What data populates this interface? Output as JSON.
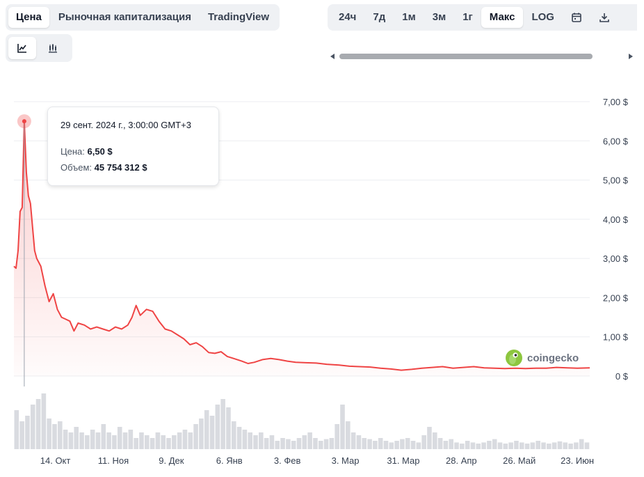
{
  "tabs": [
    {
      "label": "Цена",
      "active": true
    },
    {
      "label": "Рыночная капитализация",
      "active": false
    },
    {
      "label": "TradingView",
      "active": false
    }
  ],
  "chart_types": [
    {
      "icon": "line-chart-icon",
      "active": true
    },
    {
      "icon": "candlestick-chart-icon",
      "active": false
    }
  ],
  "ranges": [
    {
      "label": "24ч",
      "active": false
    },
    {
      "label": "7д",
      "active": false
    },
    {
      "label": "1м",
      "active": false
    },
    {
      "label": "3м",
      "active": false
    },
    {
      "label": "1г",
      "active": false
    },
    {
      "label": "Макс",
      "active": true
    },
    {
      "label": "LOG",
      "active": false
    }
  ],
  "range_icons": [
    "calendar-icon",
    "download-icon"
  ],
  "tooltip": {
    "date": "29 сент. 2024 г., 3:00:00 GMT+3",
    "price_label": "Цена:",
    "price_value": "6,50 $",
    "volume_label": "Объем:",
    "volume_value": "45 754 312 $"
  },
  "watermark": {
    "text": "coingecko",
    "icon": "gecko-logo-icon"
  },
  "colors": {
    "line": "#ef4444",
    "fill": "#fde2e2",
    "volume": "#d9dbe0",
    "grid": "#eceef1"
  },
  "chart_data": {
    "type": "area",
    "x_start": "2024-09-24",
    "x_end": "2025-06-29",
    "xticks": [
      {
        "label": "14. Окт",
        "date": "2024-10-14"
      },
      {
        "label": "11. Ноя",
        "date": "2024-11-11"
      },
      {
        "label": "9. Дек",
        "date": "2024-12-09"
      },
      {
        "label": "6. Янв",
        "date": "2025-01-06"
      },
      {
        "label": "3. Фев",
        "date": "2025-02-03"
      },
      {
        "label": "3. Мар",
        "date": "2025-03-03"
      },
      {
        "label": "31. Мар",
        "date": "2025-03-31"
      },
      {
        "label": "28. Апр",
        "date": "2025-04-28"
      },
      {
        "label": "26. Май",
        "date": "2025-05-26"
      },
      {
        "label": "23. Июн",
        "date": "2025-06-23"
      }
    ],
    "yticks": [
      "0 $",
      "1,00 $",
      "2,00 $",
      "3,00 $",
      "4,00 $",
      "5,00 $",
      "6,00 $",
      "7,00 $"
    ],
    "ylim": [
      0,
      7
    ],
    "grid": true,
    "highlight": {
      "date": "2024-09-29",
      "price": 6.5
    },
    "price": [
      [
        "2024-09-24",
        2.8
      ],
      [
        "2024-09-25",
        2.75
      ],
      [
        "2024-09-26",
        3.2
      ],
      [
        "2024-09-27",
        4.2
      ],
      [
        "2024-09-28",
        4.3
      ],
      [
        "2024-09-29",
        6.5
      ],
      [
        "2024-09-30",
        5.2
      ],
      [
        "2024-10-01",
        4.6
      ],
      [
        "2024-10-02",
        4.4
      ],
      [
        "2024-10-03",
        3.8
      ],
      [
        "2024-10-04",
        3.2
      ],
      [
        "2024-10-05",
        3.0
      ],
      [
        "2024-10-07",
        2.8
      ],
      [
        "2024-10-09",
        2.3
      ],
      [
        "2024-10-11",
        1.9
      ],
      [
        "2024-10-13",
        2.1
      ],
      [
        "2024-10-15",
        1.7
      ],
      [
        "2024-10-17",
        1.5
      ],
      [
        "2024-10-19",
        1.45
      ],
      [
        "2024-10-21",
        1.4
      ],
      [
        "2024-10-23",
        1.15
      ],
      [
        "2024-10-25",
        1.35
      ],
      [
        "2024-10-28",
        1.3
      ],
      [
        "2024-10-31",
        1.2
      ],
      [
        "2024-11-03",
        1.25
      ],
      [
        "2024-11-06",
        1.2
      ],
      [
        "2024-11-09",
        1.15
      ],
      [
        "2024-11-12",
        1.25
      ],
      [
        "2024-11-15",
        1.2
      ],
      [
        "2024-11-18",
        1.3
      ],
      [
        "2024-11-20",
        1.5
      ],
      [
        "2024-11-22",
        1.8
      ],
      [
        "2024-11-24",
        1.55
      ],
      [
        "2024-11-27",
        1.7
      ],
      [
        "2024-11-30",
        1.65
      ],
      [
        "2024-12-03",
        1.4
      ],
      [
        "2024-12-06",
        1.2
      ],
      [
        "2024-12-09",
        1.15
      ],
      [
        "2024-12-12",
        1.05
      ],
      [
        "2024-12-15",
        0.95
      ],
      [
        "2024-12-18",
        0.8
      ],
      [
        "2024-12-21",
        0.85
      ],
      [
        "2024-12-24",
        0.75
      ],
      [
        "2024-12-27",
        0.6
      ],
      [
        "2024-12-30",
        0.58
      ],
      [
        "2025-01-02",
        0.62
      ],
      [
        "2025-01-05",
        0.5
      ],
      [
        "2025-01-08",
        0.45
      ],
      [
        "2025-01-12",
        0.38
      ],
      [
        "2025-01-15",
        0.32
      ],
      [
        "2025-01-18",
        0.35
      ],
      [
        "2025-01-22",
        0.42
      ],
      [
        "2025-01-26",
        0.45
      ],
      [
        "2025-01-30",
        0.42
      ],
      [
        "2025-02-03",
        0.38
      ],
      [
        "2025-02-07",
        0.35
      ],
      [
        "2025-02-12",
        0.34
      ],
      [
        "2025-02-17",
        0.33
      ],
      [
        "2025-02-22",
        0.3
      ],
      [
        "2025-02-28",
        0.28
      ],
      [
        "2025-03-05",
        0.25
      ],
      [
        "2025-03-10",
        0.24
      ],
      [
        "2025-03-15",
        0.23
      ],
      [
        "2025-03-20",
        0.2
      ],
      [
        "2025-03-25",
        0.18
      ],
      [
        "2025-03-30",
        0.15
      ],
      [
        "2025-04-04",
        0.17
      ],
      [
        "2025-04-09",
        0.2
      ],
      [
        "2025-04-14",
        0.22
      ],
      [
        "2025-04-19",
        0.24
      ],
      [
        "2025-04-24",
        0.2
      ],
      [
        "2025-04-29",
        0.22
      ],
      [
        "2025-05-04",
        0.24
      ],
      [
        "2025-05-09",
        0.21
      ],
      [
        "2025-05-14",
        0.2
      ],
      [
        "2025-05-19",
        0.19
      ],
      [
        "2025-05-24",
        0.2
      ],
      [
        "2025-05-29",
        0.19
      ],
      [
        "2025-06-03",
        0.2
      ],
      [
        "2025-06-08",
        0.2
      ],
      [
        "2025-06-13",
        0.22
      ],
      [
        "2025-06-18",
        0.21
      ],
      [
        "2025-06-23",
        0.2
      ],
      [
        "2025-06-29",
        0.21
      ]
    ],
    "volume_relative": [
      0.7,
      0.5,
      0.6,
      0.8,
      0.9,
      1.0,
      0.55,
      0.45,
      0.5,
      0.35,
      0.3,
      0.4,
      0.3,
      0.25,
      0.35,
      0.3,
      0.45,
      0.3,
      0.25,
      0.4,
      0.3,
      0.35,
      0.2,
      0.3,
      0.25,
      0.2,
      0.3,
      0.25,
      0.2,
      0.25,
      0.3,
      0.35,
      0.3,
      0.45,
      0.55,
      0.7,
      0.6,
      0.8,
      0.9,
      0.75,
      0.5,
      0.4,
      0.35,
      0.3,
      0.25,
      0.3,
      0.2,
      0.25,
      0.15,
      0.2,
      0.18,
      0.15,
      0.2,
      0.25,
      0.3,
      0.2,
      0.15,
      0.18,
      0.2,
      0.45,
      0.8,
      0.5,
      0.3,
      0.25,
      0.2,
      0.18,
      0.15,
      0.2,
      0.15,
      0.12,
      0.15,
      0.18,
      0.2,
      0.15,
      0.12,
      0.25,
      0.4,
      0.3,
      0.2,
      0.15,
      0.18,
      0.12,
      0.1,
      0.15,
      0.12,
      0.1,
      0.12,
      0.15,
      0.18,
      0.12,
      0.1,
      0.12,
      0.15,
      0.12,
      0.1,
      0.12,
      0.15,
      0.12,
      0.1,
      0.12,
      0.14,
      0.12,
      0.1,
      0.12,
      0.18,
      0.12
    ]
  }
}
